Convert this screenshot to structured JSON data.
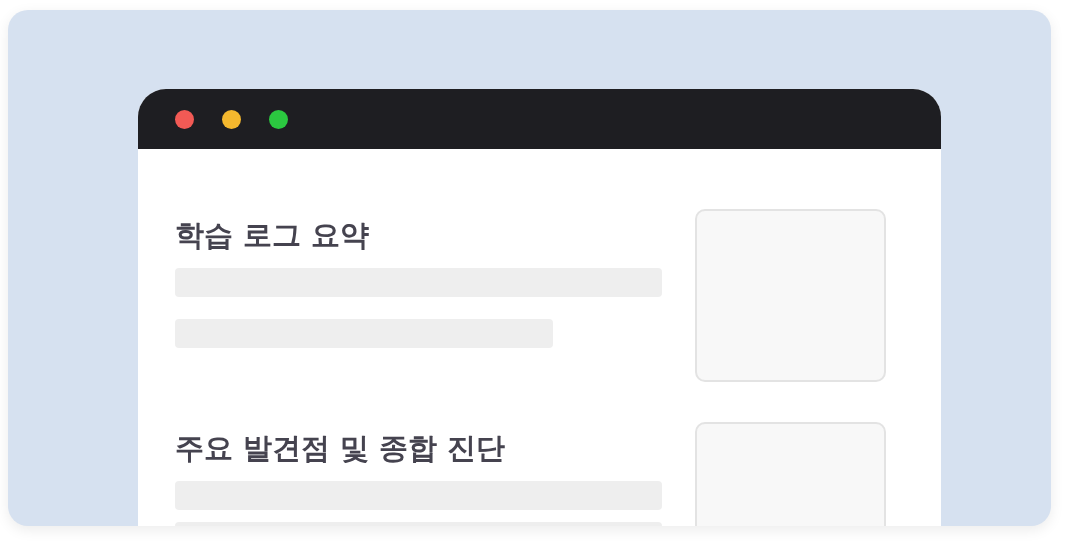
{
  "sections": [
    {
      "heading": "학습 로그 요약"
    },
    {
      "heading": "주요 발견점 및 종합 진단"
    }
  ]
}
